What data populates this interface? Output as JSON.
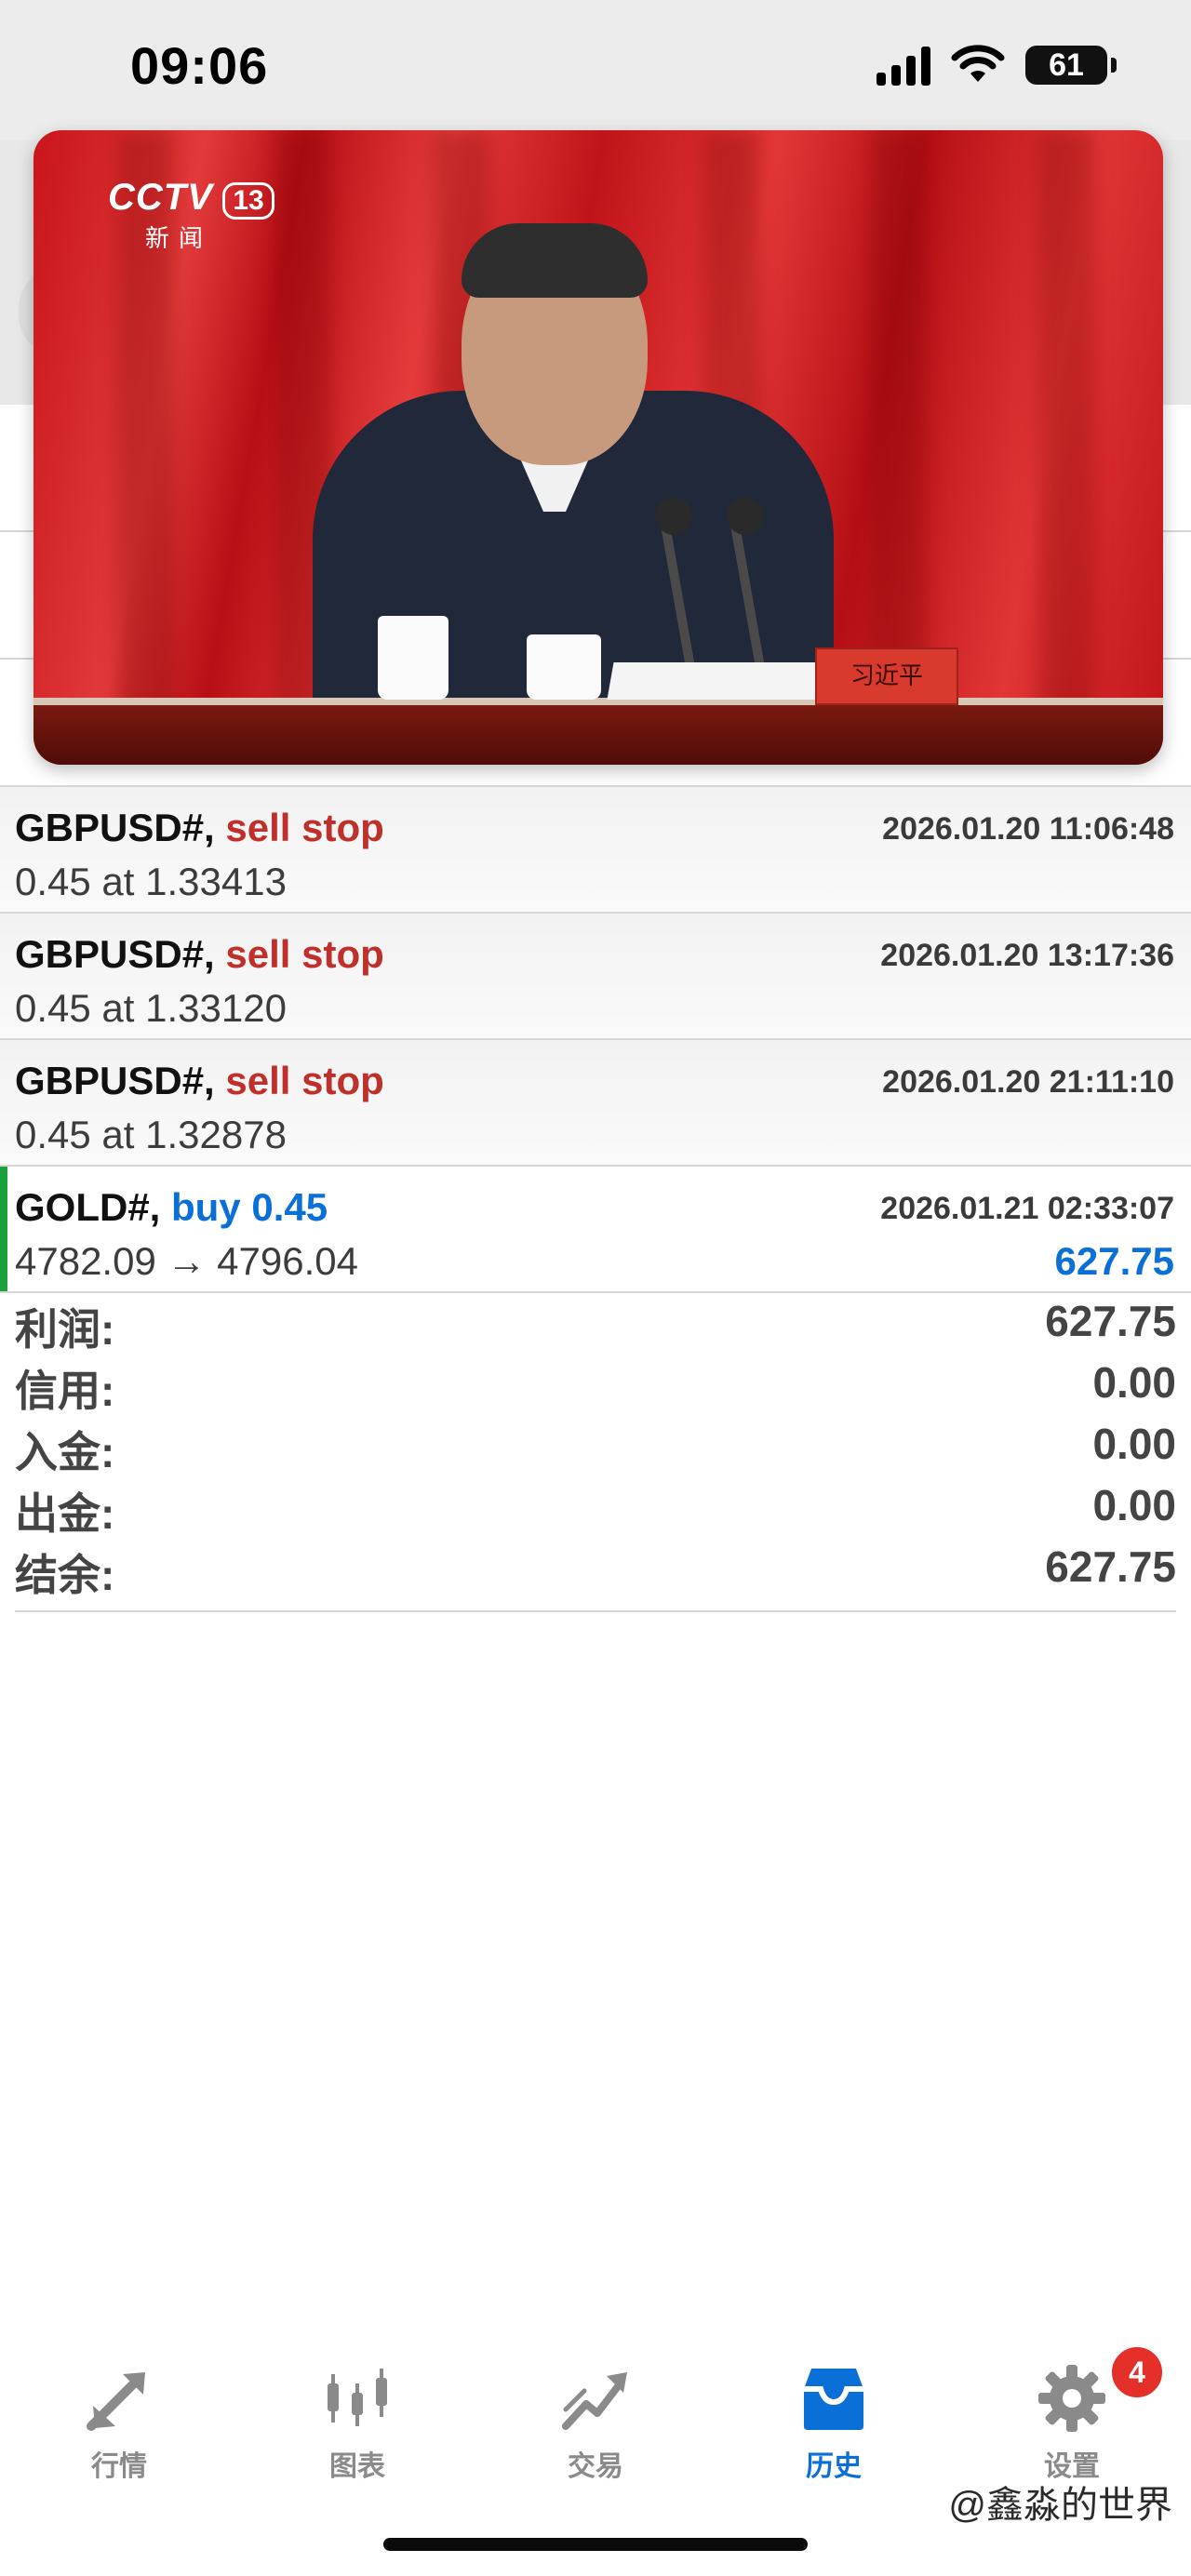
{
  "status_bar": {
    "time": "09:06",
    "battery": "61"
  },
  "orders": [
    {
      "symbol": "GBPUSD#,",
      "type": "sell stop",
      "type_class": "sell",
      "date": "2026.01.20 11:06:48",
      "detail": "0.45 at 1.33413",
      "profit": ""
    },
    {
      "symbol": "GBPUSD#,",
      "type": "sell stop",
      "type_class": "sell",
      "date": "2026.01.20 13:17:36",
      "detail": "0.45 at 1.33120",
      "profit": ""
    },
    {
      "symbol": "GBPUSD#,",
      "type": "sell stop",
      "type_class": "sell",
      "date": "2026.01.20 21:11:10",
      "detail": "0.45 at 1.32878",
      "profit": ""
    },
    {
      "symbol": "GOLD#,",
      "type": "buy 0.45",
      "type_class": "buy",
      "date": "2026.01.21 02:33:07",
      "detail": "4782.09 → 4796.04",
      "profit": "627.75"
    }
  ],
  "summary": [
    {
      "label": "利润:",
      "value": "627.75"
    },
    {
      "label": "信用:",
      "value": "0.00"
    },
    {
      "label": "入金:",
      "value": "0.00"
    },
    {
      "label": "出金:",
      "value": "0.00"
    },
    {
      "label": "结余:",
      "value": "627.75"
    }
  ],
  "video": {
    "channel": "CCTV",
    "channel_number": "13",
    "channel_sub": "新闻",
    "nameplate": "习近平"
  },
  "tabs": [
    {
      "label": "行情",
      "icon": "quotes-arrows-icon",
      "active": false
    },
    {
      "label": "图表",
      "icon": "candlestick-chart-icon",
      "active": false
    },
    {
      "label": "交易",
      "icon": "trade-trend-icon",
      "active": false
    },
    {
      "label": "历史",
      "icon": "history-inbox-icon",
      "active": true
    },
    {
      "label": "设置",
      "icon": "gear-icon",
      "active": false,
      "badge": "4"
    }
  ],
  "watermark": "@鑫淼的世界",
  "colors": {
    "sell": "#c0302b",
    "buy": "#0a6fd6",
    "accent": "#0a6fd6",
    "active_indicator": "#1aa13a",
    "badge": "#e5302a"
  }
}
